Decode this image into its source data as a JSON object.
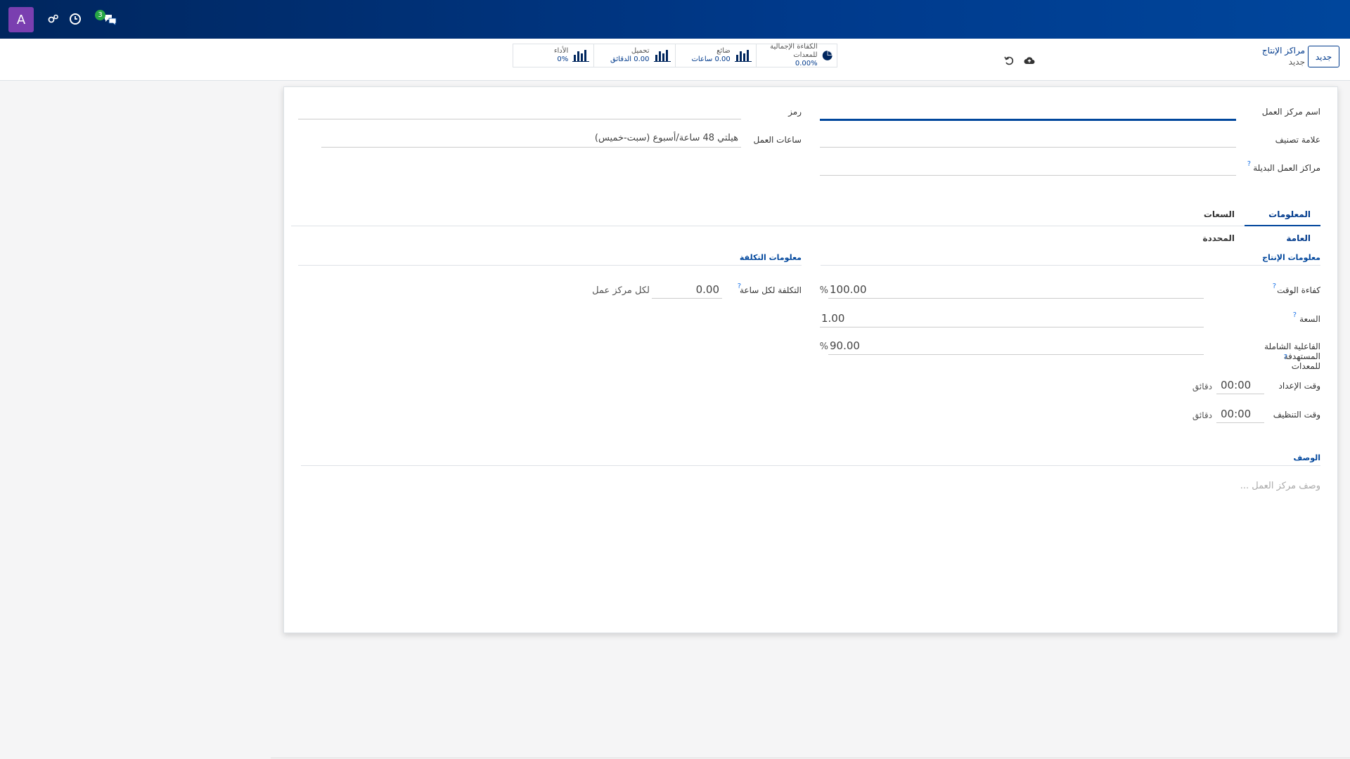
{
  "navbar": {
    "avatar_letter": "A",
    "badge_count": "3",
    "icons": [
      "avatar",
      "settings-icon",
      "clock-icon",
      "chat-icon"
    ]
  },
  "control_panel": {
    "new_button": "جديد",
    "breadcrumb_parent": "مراكز الإنتاج",
    "breadcrumb_current": "جديد",
    "stats": [
      {
        "label": "الكفاءة الإجمالية للمعدات",
        "value": "0.00%",
        "icon": "pie-chart-icon"
      },
      {
        "label": "ضائع",
        "value": "0.00 ساعات",
        "icon": "bar-chart-icon"
      },
      {
        "label": "تحميل",
        "value": "0.00 الدقائق",
        "icon": "bar-chart-icon"
      },
      {
        "label": "الأداء",
        "value": "0%",
        "icon": "bar-chart-icon"
      }
    ]
  },
  "form": {
    "workcenter_name_label": "اسم مركز العمل",
    "tag_label": "علامة تصنيف",
    "alternative_label": "مراكز العمل البديلة",
    "code_label": "رمز",
    "working_hours_label": "ساعات العمل",
    "working_hours_value": "هيلتي 48 ساعة/أسبوع (سبت-خميس)",
    "tabs": [
      "المعلومات العامة",
      "السعات المحددة"
    ],
    "production_info_title": "معلومات الإنتاج",
    "cost_info_title": "معلومات التكلفة",
    "time_efficiency_label": "كفاءة الوقت",
    "time_efficiency_value": "100.00",
    "percent_sign": "%",
    "capacity_label": "السعة",
    "capacity_value": "1.00",
    "oee_target_label_1": "الفاعلية الشاملة المستهدفة",
    "oee_target_label_2": "للمعدات",
    "oee_target_value": "90.00",
    "setup_time_label": "وقت الإعداد",
    "setup_time_value": "00:00",
    "cleanup_time_label": "وقت التنظيف",
    "cleanup_time_value": "00:00",
    "minutes_unit": "دقائق",
    "cost_per_hour_label": "التكلفة لكل ساعة",
    "cost_per_hour_value": "0.00",
    "cost_unit": "لكل مركز عمل",
    "description_title": "الوصف",
    "description_placeholder": "وصف مركز العمل ..."
  }
}
